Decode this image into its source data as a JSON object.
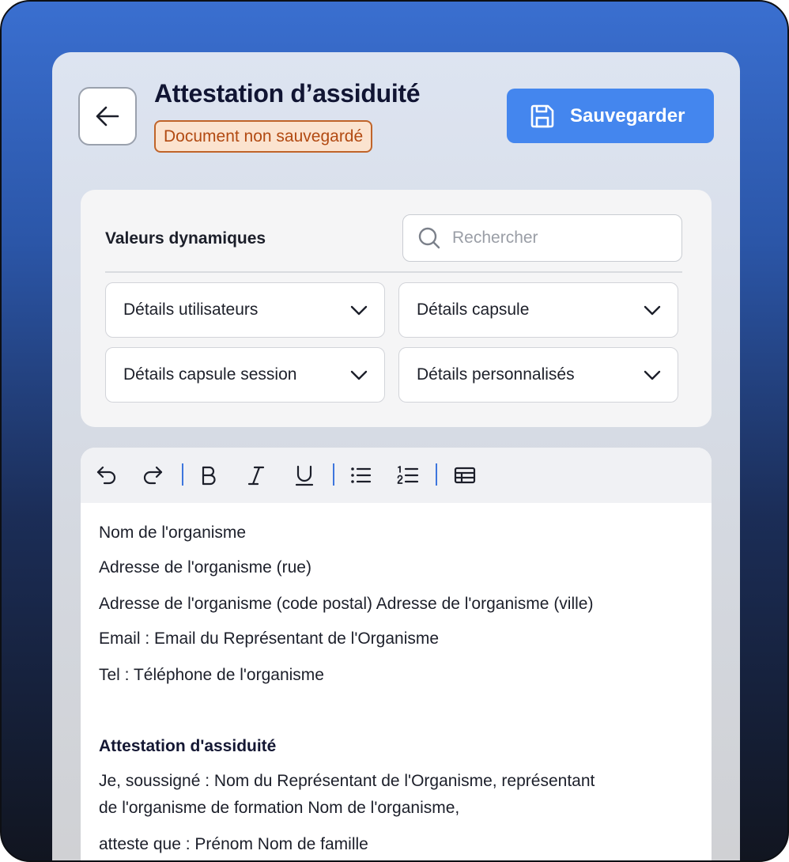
{
  "header": {
    "title": "Attestation d’assiduité",
    "status_badge": "Document non sauvegardé",
    "save_label": "Sauvegarder"
  },
  "dynamic_values": {
    "title": "Valeurs dynamiques",
    "search_placeholder": "Rechercher",
    "dropdowns": [
      "Détails utilisateurs",
      "Détails capsule",
      "Détails capsule session",
      "Détails personnalisés"
    ]
  },
  "toolbar": {
    "buttons": [
      "undo-icon",
      "redo-icon",
      "bold-icon",
      "italic-icon",
      "underline-icon",
      "bullet-list-icon",
      "numbered-list-icon",
      "table-icon"
    ]
  },
  "editor": {
    "lines": [
      "Nom de l'organisme",
      "Adresse de l'organisme (rue)",
      "Adresse de l'organisme (code postal) Adresse de l'organisme (ville)",
      "Email : Email du Représentant de l'Organisme",
      "Tel : Téléphone de l'organisme",
      "Attestation d'assiduité",
      "Je, soussigné : Nom du Représentant de l'Organisme, représentant",
      "de l'organisme de formation Nom de l'organisme,",
      "atteste que : Prénom Nom de famille"
    ]
  },
  "colors": {
    "accent": "#4486ee",
    "badge_border": "#c0642a",
    "badge_bg": "#fbe3cf",
    "badge_text": "#b24a12"
  }
}
